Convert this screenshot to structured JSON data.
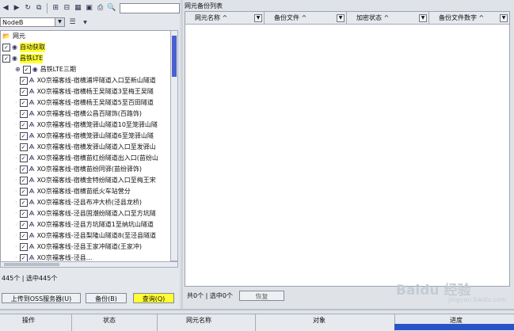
{
  "toolbar": {
    "icons": [
      "back-icon",
      "forward-icon",
      "refresh-icon",
      "copy-icon",
      "expand-icon",
      "collapse-icon",
      "grid-icon",
      "save-icon",
      "print-icon",
      "search-icon"
    ]
  },
  "filter": {
    "combo_value": "NodeB"
  },
  "tree": {
    "root": "网元",
    "nodes": [
      {
        "label": "自动获取",
        "highlight": true
      },
      {
        "label": "昌铁LTE",
        "highlight": true
      },
      {
        "label": "昌铁LTE三期"
      },
      {
        "label": "XO京福客线-宿横浦坪隧道入口至新山隧道"
      },
      {
        "label": "XO京福客线-宿横杨王吴隧道3至梅王吴隧"
      },
      {
        "label": "XO京福客线-宿横杨王吴隧道5至百田隧道"
      },
      {
        "label": "XO京福客线-宿横公昌百隧饰(百路饰)"
      },
      {
        "label": "XO京福客线-宿横笼驿山隧道10至笼驿山隧"
      },
      {
        "label": "XO京福客线-宿横笼驿山隧道6至笼驿山隧"
      },
      {
        "label": "XO京福客线-宿横发驿山隧道入口至发驿山"
      },
      {
        "label": "XO京福客线-宿横苗红纷隧道出入口(苗纷山"
      },
      {
        "label": "XO京福客线-宿横苗纷同驿(苗纷驿饰)"
      },
      {
        "label": "XO京福客线-宿横金特纷隧道入口至梅王宋"
      },
      {
        "label": "XO京福客线-宿横苗纸火车站营分"
      },
      {
        "label": "XO京福客线-泾县布冲大桥(泾县龙桥)"
      },
      {
        "label": "XO京福客线-泾县固潮纷隧道入口至方坑隧"
      },
      {
        "label": "XO京福客线-泾县方坑隧道1至纳坑山隧道"
      },
      {
        "label": "XO京福客线-泾县梨隆山隧道8(至泾县隧道"
      },
      {
        "label": "XO京福客线-泾县王家冲隧道(王家冲)"
      },
      {
        "label": "XO京福客线-泾县..."
      }
    ]
  },
  "left_status": "445个 | 选中445个",
  "buttons": {
    "upload": "上传到OSS服务器(U)",
    "backup": "备份(B)",
    "query": "查询(Q)"
  },
  "right_panel": {
    "title": "网元备份列表",
    "columns": [
      "网元名称",
      "备份文件",
      "加密状态",
      "备份文件数字"
    ],
    "count_text": "共0个 | 选中0个",
    "restore_label": "恢复"
  },
  "bottom": {
    "columns": [
      "操作",
      "状态",
      "网元名称",
      "对象",
      "进度"
    ]
  },
  "watermark": {
    "main": "Baidu 经验",
    "sub": "jingyan.baidu.com"
  }
}
